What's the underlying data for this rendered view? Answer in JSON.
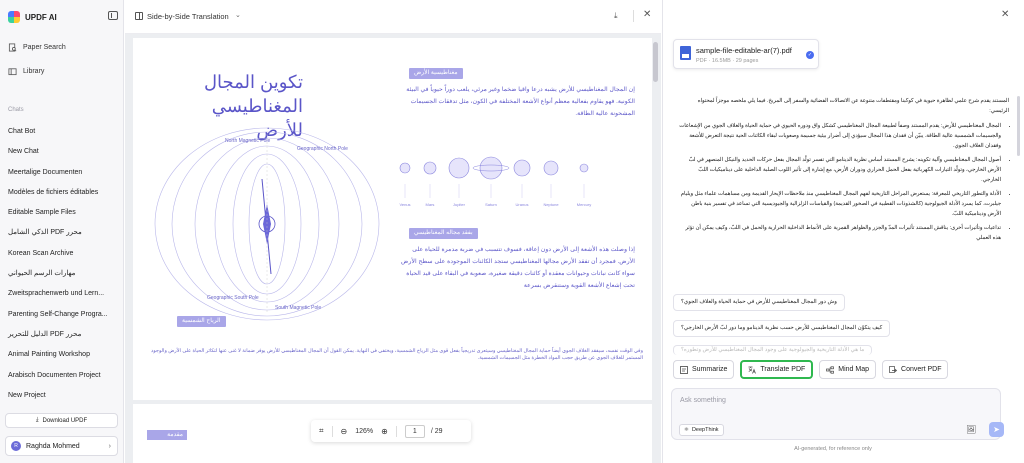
{
  "sidebar": {
    "app_name": "UPDF AI",
    "nav": [
      {
        "label": "Paper Search",
        "icon": "paper-search-icon"
      },
      {
        "label": "Library",
        "icon": "library-icon"
      }
    ],
    "section_label": "Chats",
    "chats": [
      "Chat Bot",
      "New Chat",
      "Meertalige Documenten",
      "Modèles de fichiers éditables",
      "Editable Sample Files",
      "الذكي الشامل PDF محرر",
      "Korean Scan Archive",
      "مهارات الرسم الحيواني",
      "Zweitsprachenwerb und Lern...",
      "Parenting Self-Change Progra...",
      "الدليل للتحرير PDF محرر",
      "Animal Painting Workshop",
      "Arabisch Documenten Project",
      "New Project"
    ],
    "download_label": "Download UPDF",
    "user_name": "Raghda Mohmed",
    "user_initial": "R"
  },
  "doc": {
    "title": "Side-by-Side Translation",
    "page_heading_line1": "تكوين المجال",
    "page_heading_line2": "المغناطيسي للأرض",
    "label_magnetism": "مغناطيسية الأرض",
    "para1": "إن المجال المغناطيسي للأرض يشبه درعا واقيا ضخما وغير مرئي، يلعب دوراً حيوياً في البيئة الكونية. فهو يقاوم بفعالية معظم أنواع الأشعة المختلفة في الكون، مثل تدفقات الجسيمات المشحونة عالية الطاقة.",
    "label_after": "بفقد مجاله المغناطيسي",
    "para2": "إذا وصلت هذه الأشعة إلى الأرض دون إعاقة، فسوف تتسبب في ضربة مدمرة للحياة على الأرض. فمجرد أن تفقد الأرض مجالها المغناطيسي ستجد الكائنات الموجودة على سطح الأرض سواء كانت نباتات وحيوانات معقدة أو كائنات دقيقة صغيرة، صعوبة في البقاء على قيد الحياة تحت إشعاع الأشعة القوية وستنقرض بسرعة",
    "label_wind": "الرياح الشمسية",
    "caption": "وفي الوقت نفسه، سيفقد الغلاف الجوي أيضاً حماية المجال المغناطيسي وسيتعرى تدريجياً بفعل قوى مثل الرياح الشمسية، ويختفي في النهاية. يمكن القول أن المجال المغناطيسي للأرض يوفر ضمانة لا غنى عنها لتكاثر الحياة على الأرض والوجود المستمر للغلاف الجوي عن طريق حجب المواد الخطرة مثل الجسيمات الشمسية.",
    "planets": [
      "Venus",
      "Mars",
      "Jupiter",
      "Saturn",
      "Uranus",
      "Neptune",
      "Mercury"
    ],
    "diagram_labels": {
      "north_mag": "North Magnetic Pole",
      "geo_north": "Geographic North Pole",
      "geo_south": "Geographic South Pole",
      "south_mag": "South Magnetic Pole"
    },
    "page2_label": "مقدمة",
    "toolbar": {
      "zoom": "126%",
      "page": "1",
      "total": "/ 29"
    }
  },
  "chat": {
    "file_name": "sample-file-editable-ar(7).pdf",
    "file_meta": "PDF · 16.5MB · 29 pages",
    "answer_intro": "المستند يقدم شرح علمي لظاهرة حيوية في كوكبنا ومقتطفات متنوعة عن الاتصالات الفضائية والسفر إلى المريخ. فيما يلي ملخصه موجزاً لمحتواه الرئيسي:",
    "bullets": [
      "المجال المغناطيسي للأرض: يقدم المستند وصفاً لطبيعة المجال المغناطيسي كشكل واق ودوره الحيوي في حماية الحياة والغلاف الجوي من الإشعاعات والجسيمات الشمسية عالية الطاقة. يبيّن أن فقدان هذا المجال سيؤدي إلى أضرار بيئية جسيمة وصعوبات لبقاء الكائنات الحية نتيجة التعرض للأشعة وفقدان الغلاف الجوي.",
      "أصول المجال المغناطيسي وآلية تكوينه: يشرح المستند أساس نظرية الدينامو التي تفسر تولّد المجال بفعل حركات الحديد والنيكل المنصهر في لبّ الأرض الخارجي، وتولّد التيارات الكهربائية بفعل الحمل الحراري ودوران الأرض، مع إشارة إلى تأثير اللوب الصلبة الداخلية على ديناميكيات اللبّ الخارجي.",
      "الأدلة والتطور التاريخي للمعرفة: يستعرض المراحل التاريخية لفهم المجال المغناطيسي منذ ملاحظات الإبحار القديمة ومن مساهمات علماء مثل ويليام جيلبرت، كما يسرد الأدلة الجيولوجية (كالشذوذات القطبية في الصخور القديمة) والقياسات الزلزالية والجيوديسية التي تساعد في تفسير بنية باطن الأرض وديناميكية اللبّ.",
      "تداعيات وتأثيرات أخرى: يناقش المستند تأثيرات المدّ والجزر والظواهر القمرية على الأنماط الداخلية الحرارية والحمل في اللبّ، وكيف يمكن أن تؤثر هذه العملي"
    ],
    "suggestions": [
      "وش دور المجال المغناطيسي للأرض في حماية الحياة والغلاف الجوي؟",
      "كيف يتكوّن المجال المغناطيسي للأرض حسب نظرية الدينامو وما دور لبّ الأرض الخارجي؟",
      "ما هي الأدلة التاريخية والجيولوجية على وجود المجال المغناطيسي للأرض وتطوره؟"
    ],
    "actions": {
      "summarize": "Summarize",
      "translate": "Translate PDF",
      "mindmap": "Mind Map",
      "convert": "Convert PDF"
    },
    "input_placeholder": "Ask something",
    "deepthink": "DeepThink",
    "note": "AI-generated, for reference only"
  },
  "colors": {
    "accent": "#5a55c8",
    "highlight": "#2fb84f",
    "send": "#a6b8f7"
  }
}
